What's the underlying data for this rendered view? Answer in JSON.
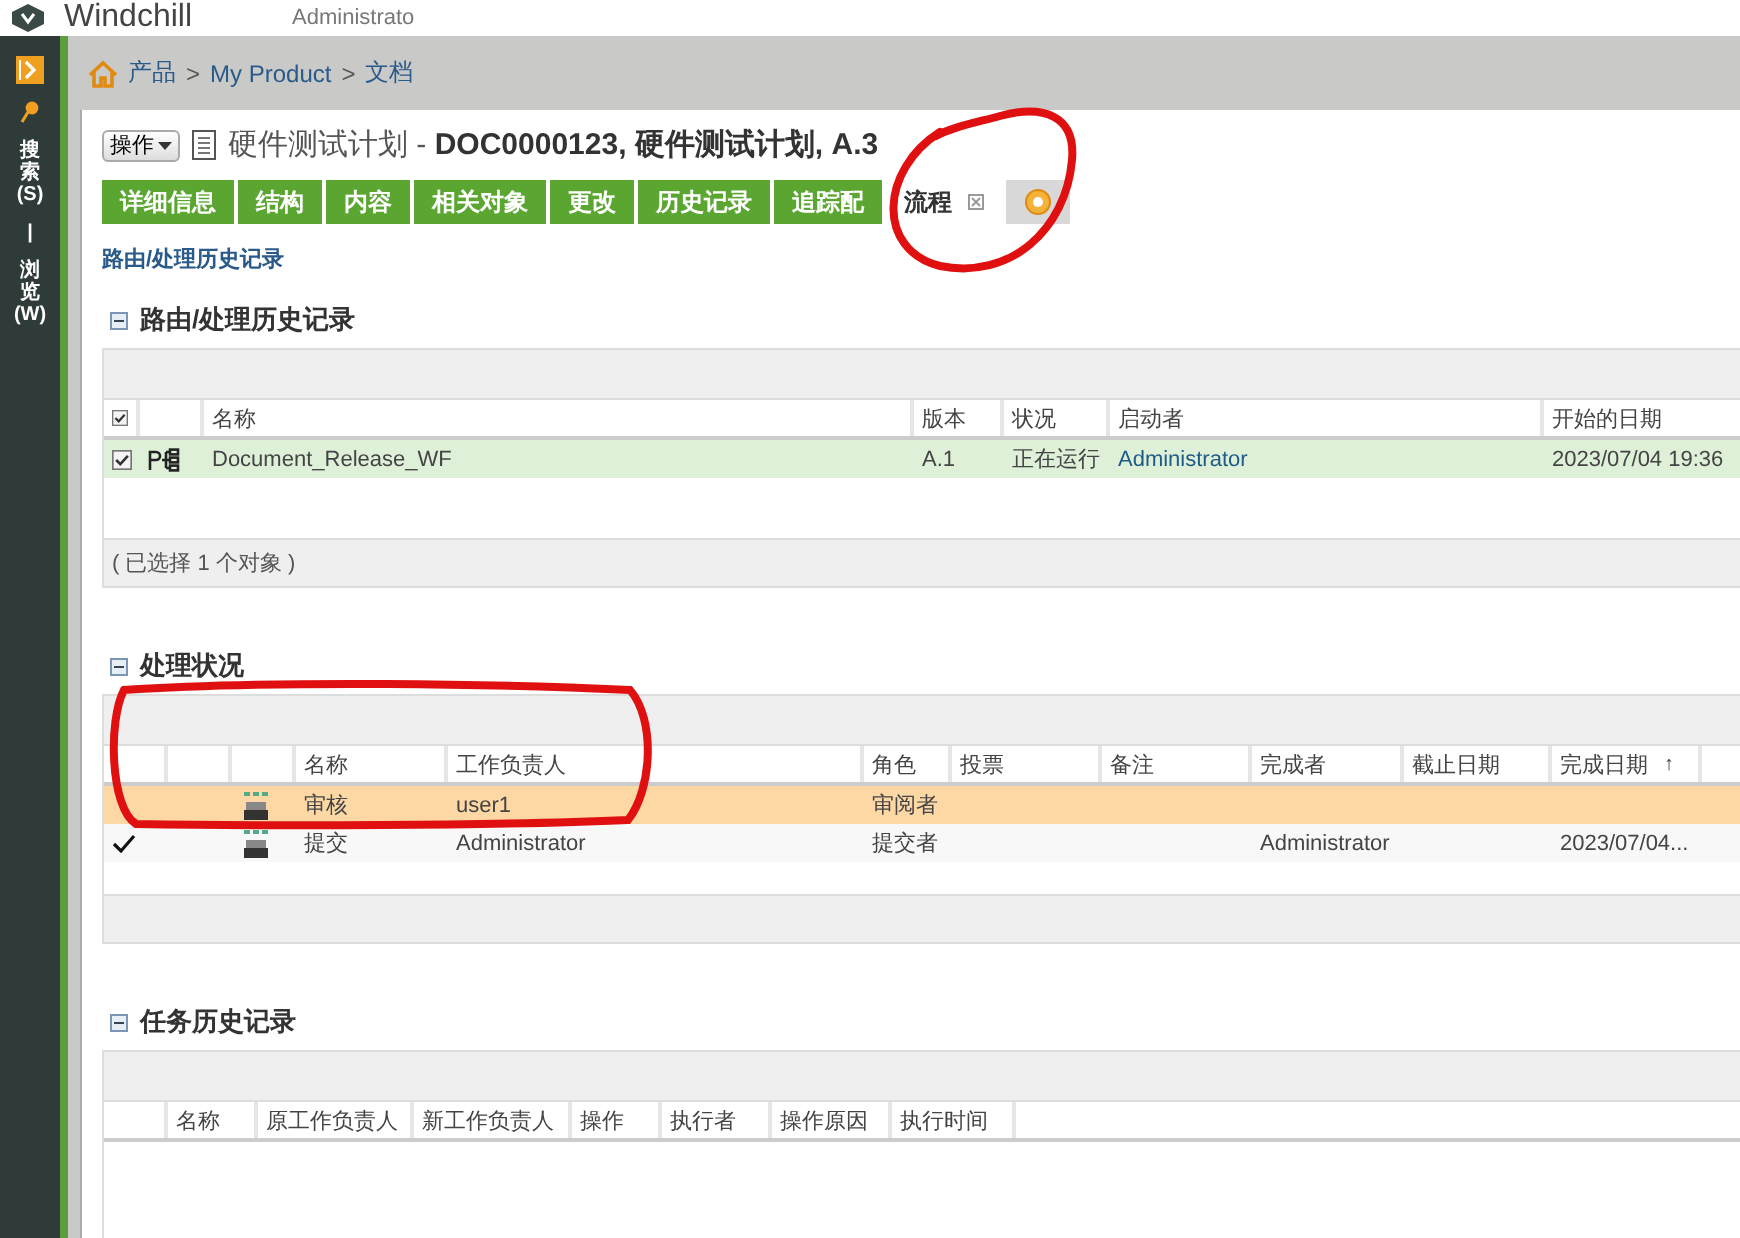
{
  "header": {
    "logo": "Windchill",
    "user": "Administrato"
  },
  "sidebar": {
    "items": [
      {
        "label": "搜索(S)"
      },
      {
        "label": "浏览(W)"
      }
    ],
    "separator": "|"
  },
  "breadcrumb": {
    "items": [
      "产品",
      "My Product",
      "文档"
    ],
    "separator": ">"
  },
  "object": {
    "actions_button": "操作",
    "title": "硬件测试计划 - **DOC0000123, 硬件测试计划, A.3**"
  },
  "tabs": [
    {
      "kind": "text",
      "label": "详细信息",
      "selected": false
    },
    {
      "kind": "text",
      "label": "结构",
      "selected": false
    },
    {
      "kind": "text",
      "label": "内容",
      "selected": false
    },
    {
      "kind": "text",
      "label": "相关对象",
      "selected": false
    },
    {
      "kind": "text",
      "label": "更改",
      "selected": false
    },
    {
      "kind": "text",
      "label": "历史记录",
      "selected": false
    },
    {
      "kind": "text",
      "label": "追踪配",
      "selected": false
    },
    {
      "kind": "text",
      "label": "流程",
      "selected": true,
      "closable": true
    },
    {
      "kind": "icon",
      "selected": false
    }
  ],
  "page_link": "路由/处理历史记录",
  "sections": [
    {
      "title": "路由/处理历史记录",
      "expanded": true,
      "columns": [
        {
          "kind": "check",
          "checked": true
        },
        {
          "kind": "icon"
        },
        {
          "kind": "text",
          "label": "名称"
        },
        {
          "kind": "text",
          "label": "版本"
        },
        {
          "kind": "text",
          "label": "状况"
        },
        {
          "kind": "text",
          "label": "启动者",
          "links": true
        },
        {
          "kind": "text",
          "label": "开始的日期"
        }
      ],
      "rows": [
        {
          "kind": "workflow",
          "selected": true,
          "checked": true,
          "cells": [
            "",
            "",
            "Document_Release_WF",
            "A.1",
            "正在运行",
            "Administrator",
            "2023/07/04 19:36"
          ]
        }
      ],
      "footer": "( 已选择 1 个对象 )"
    },
    {
      "title": "处理状况",
      "expanded": true,
      "columns": [
        {
          "kind": "done"
        },
        {
          "kind": "blank"
        },
        {
          "kind": "icon"
        },
        {
          "kind": "text",
          "label": "名称"
        },
        {
          "kind": "text",
          "label": "工作负责人"
        },
        {
          "kind": "text",
          "label": "角色"
        },
        {
          "kind": "text",
          "label": "投票"
        },
        {
          "kind": "text",
          "label": "备注"
        },
        {
          "kind": "text",
          "label": "完成者"
        },
        {
          "kind": "text",
          "label": "截止日期"
        },
        {
          "kind": "text",
          "label": "完成日期",
          "sort": "↑"
        },
        {
          "kind": "blank"
        }
      ],
      "rows": [
        {
          "kind": "task",
          "selected": true,
          "done": false,
          "cells": [
            "",
            "",
            "",
            "审核",
            "user1",
            "审阅者",
            "",
            "",
            "",
            "",
            "",
            ""
          ]
        },
        {
          "kind": "task",
          "selected": false,
          "done": true,
          "cells": [
            "",
            "",
            "",
            "提交",
            "Administrator",
            "提交者",
            "",
            "",
            "Administrator",
            "",
            "2023/07/04...",
            ""
          ]
        }
      ]
    },
    {
      "title": "任务历史记录",
      "expanded": true,
      "columns": [
        {
          "kind": "blank"
        },
        {
          "kind": "text",
          "label": "名称"
        },
        {
          "kind": "text",
          "label": "原工作负责人"
        },
        {
          "kind": "text",
          "label": "新工作负责人"
        },
        {
          "kind": "text",
          "label": "操作"
        },
        {
          "kind": "text",
          "label": "执行者"
        },
        {
          "kind": "text",
          "label": "操作原因"
        },
        {
          "kind": "text",
          "label": "执行时间"
        },
        {
          "kind": "blank"
        }
      ]
    }
  ]
}
